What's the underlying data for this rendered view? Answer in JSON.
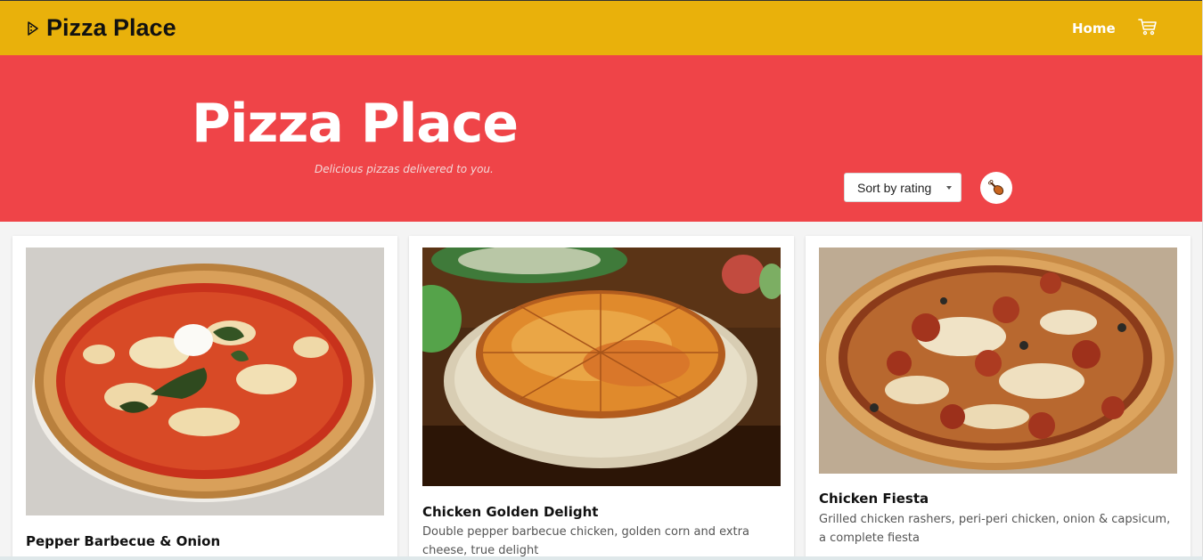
{
  "navbar": {
    "brand": "Pizza Place",
    "brand_icon": "pizza-slice-icon",
    "home_link": "Home",
    "cart_icon": "shopping-cart-icon",
    "bg_color": "#e9b10b"
  },
  "hero": {
    "title": "Pizza Place",
    "subtitle": "Delicious pizzas delivered to you.",
    "sort_selected": "Sort by rating",
    "filter_icon": "chicken-leg-icon",
    "bg_color": "#ef4448"
  },
  "products": [
    {
      "name": "Pepper Barbecue & Onion",
      "description": "",
      "image_icon": "margherita-pizza-photo"
    },
    {
      "name": "Chicken Golden Delight",
      "description": "Double pepper barbecue chicken, golden corn and extra cheese, true delight",
      "image_icon": "cheese-pizza-photo"
    },
    {
      "name": "Chicken Fiesta",
      "description": "Grilled chicken rashers, peri-peri chicken, onion & capsicum, a complete fiesta",
      "image_icon": "pepperoni-pizza-photo"
    }
  ]
}
